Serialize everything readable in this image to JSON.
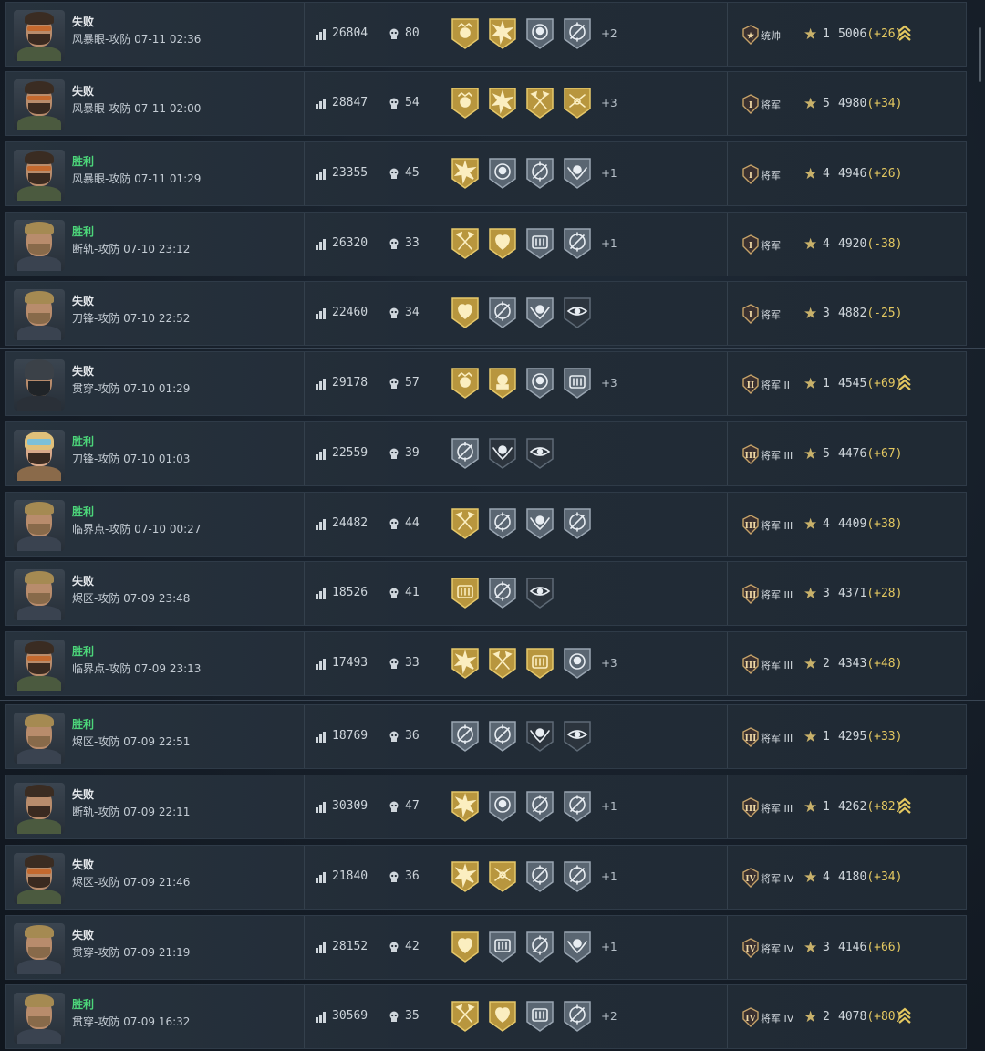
{
  "colors": {
    "win": "#4cd67a",
    "lose": "#e9ecef",
    "delta": "#e4c860",
    "gold_medal": "#b8963e",
    "silver_medal": "#5a6672"
  },
  "matches": [
    {
      "result": "失败",
      "result_type": "lose",
      "map": "风暴眼-攻防",
      "time": "07-11 02:36",
      "score": "26804",
      "kills": "80",
      "avatar": "male-glasses",
      "medals": [
        {
          "type": "gold",
          "icon": "skull-crown-icon"
        },
        {
          "type": "gold",
          "icon": "burst-icon"
        },
        {
          "type": "silver",
          "icon": "skull-icon"
        },
        {
          "type": "silver",
          "icon": "crosshair-icon"
        }
      ],
      "more": "+2",
      "rank_roman": "★",
      "rank_name": "统帅",
      "stars": "1",
      "rating": "5006",
      "delta": "(+26)",
      "promo": true
    },
    {
      "result": "失败",
      "result_type": "lose",
      "map": "风暴眼-攻防",
      "time": "07-11 02:00",
      "score": "28847",
      "kills": "54",
      "avatar": "male-glasses",
      "medals": [
        {
          "type": "gold",
          "icon": "skull-crown-icon"
        },
        {
          "type": "gold",
          "icon": "burst-icon"
        },
        {
          "type": "gold",
          "icon": "axes-icon"
        },
        {
          "type": "gold",
          "icon": "crossed-blades-icon"
        }
      ],
      "more": "+3",
      "rank_roman": "I",
      "rank_name": "将军",
      "stars": "5",
      "rating": "4980",
      "delta": "(+34)",
      "promo": false
    },
    {
      "result": "胜利",
      "result_type": "win",
      "map": "风暴眼-攻防",
      "time": "07-11 01:29",
      "score": "23355",
      "kills": "45",
      "avatar": "male-glasses",
      "medals": [
        {
          "type": "gold",
          "icon": "burst-icon"
        },
        {
          "type": "silver",
          "icon": "skull-icon"
        },
        {
          "type": "silver",
          "icon": "crosshair-icon"
        },
        {
          "type": "silver",
          "icon": "skull-wings-icon"
        }
      ],
      "more": "+1",
      "rank_roman": "I",
      "rank_name": "将军",
      "stars": "4",
      "rating": "4946",
      "delta": "(+26)",
      "promo": false
    },
    {
      "result": "胜利",
      "result_type": "win",
      "map": "断轨-攻防",
      "time": "07-10 23:12",
      "score": "26320",
      "kills": "33",
      "avatar": "male-blond",
      "medals": [
        {
          "type": "gold",
          "icon": "axes-icon"
        },
        {
          "type": "gold",
          "icon": "heart-icon"
        },
        {
          "type": "silver",
          "icon": "crate-icon"
        },
        {
          "type": "silver",
          "icon": "crosshair-icon"
        }
      ],
      "more": "+1",
      "rank_roman": "I",
      "rank_name": "将军",
      "stars": "4",
      "rating": "4920",
      "delta": "(-38)",
      "promo": false
    },
    {
      "result": "失败",
      "result_type": "lose",
      "map": "刀锋-攻防",
      "time": "07-10 22:52",
      "score": "22460",
      "kills": "34",
      "avatar": "male-blond",
      "medals": [
        {
          "type": "gold",
          "icon": "heart-icon"
        },
        {
          "type": "silver",
          "icon": "crosshair-icon"
        },
        {
          "type": "silver",
          "icon": "skull-wings-icon"
        },
        {
          "type": "dark",
          "icon": "eye-icon"
        }
      ],
      "more": "",
      "rank_roman": "I",
      "rank_name": "将军",
      "stars": "3",
      "rating": "4882",
      "delta": "(-25)",
      "promo": false
    },
    {
      "result": "失败",
      "result_type": "lose",
      "map": "贯穿-攻防",
      "time": "07-10 01:29",
      "score": "29178",
      "kills": "57",
      "avatar": "male-helmet",
      "medals": [
        {
          "type": "gold",
          "icon": "skull-crown-icon"
        },
        {
          "type": "gold",
          "icon": "skull-gold-icon"
        },
        {
          "type": "silver",
          "icon": "skull-icon"
        },
        {
          "type": "silver",
          "icon": "crate-icon"
        }
      ],
      "more": "+3",
      "rank_roman": "II",
      "rank_name": "将军 II",
      "stars": "1",
      "rating": "4545",
      "delta": "(+69)",
      "promo": true
    },
    {
      "result": "胜利",
      "result_type": "win",
      "map": "刀锋-攻防",
      "time": "07-10 01:03",
      "score": "22559",
      "kills": "39",
      "avatar": "female",
      "medals": [
        {
          "type": "silver",
          "icon": "crosshair-icon"
        },
        {
          "type": "dark",
          "icon": "skull-wings-icon"
        },
        {
          "type": "dark",
          "icon": "eye-icon"
        }
      ],
      "more": "",
      "rank_roman": "III",
      "rank_name": "将军 III",
      "stars": "5",
      "rating": "4476",
      "delta": "(+67)",
      "promo": false
    },
    {
      "result": "胜利",
      "result_type": "win",
      "map": "临界点-攻防",
      "time": "07-10 00:27",
      "score": "24482",
      "kills": "44",
      "avatar": "male-blond",
      "medals": [
        {
          "type": "gold",
          "icon": "axes-icon"
        },
        {
          "type": "silver",
          "icon": "crosshair-icon"
        },
        {
          "type": "silver",
          "icon": "skull-wings-icon"
        },
        {
          "type": "silver",
          "icon": "crosshair-icon"
        }
      ],
      "more": "",
      "rank_roman": "III",
      "rank_name": "将军 III",
      "stars": "4",
      "rating": "4409",
      "delta": "(+38)",
      "promo": false
    },
    {
      "result": "失败",
      "result_type": "lose",
      "map": "烬区-攻防",
      "time": "07-09 23:48",
      "score": "18526",
      "kills": "41",
      "avatar": "male-blond",
      "medals": [
        {
          "type": "gold",
          "icon": "crate-icon"
        },
        {
          "type": "silver",
          "icon": "crosshair-icon"
        },
        {
          "type": "dark",
          "icon": "eye-icon"
        }
      ],
      "more": "",
      "rank_roman": "III",
      "rank_name": "将军 III",
      "stars": "3",
      "rating": "4371",
      "delta": "(+28)",
      "promo": false
    },
    {
      "result": "胜利",
      "result_type": "win",
      "map": "临界点-攻防",
      "time": "07-09 23:13",
      "score": "17493",
      "kills": "33",
      "avatar": "male-glasses",
      "medals": [
        {
          "type": "gold",
          "icon": "burst-icon"
        },
        {
          "type": "gold",
          "icon": "axes-icon"
        },
        {
          "type": "gold",
          "icon": "crate-icon"
        },
        {
          "type": "silver",
          "icon": "skull-icon"
        }
      ],
      "more": "+3",
      "rank_roman": "III",
      "rank_name": "将军 III",
      "stars": "2",
      "rating": "4343",
      "delta": "(+48)",
      "promo": false
    },
    {
      "result": "胜利",
      "result_type": "win",
      "map": "烬区-攻防",
      "time": "07-09 22:51",
      "score": "18769",
      "kills": "36",
      "avatar": "male-blond",
      "medals": [
        {
          "type": "silver",
          "icon": "crosshair-icon"
        },
        {
          "type": "silver",
          "icon": "crosshair-icon"
        },
        {
          "type": "dark",
          "icon": "skull-wings-icon"
        },
        {
          "type": "dark",
          "icon": "eye-icon"
        }
      ],
      "more": "",
      "rank_roman": "III",
      "rank_name": "将军 III",
      "stars": "1",
      "rating": "4295",
      "delta": "(+33)",
      "promo": false
    },
    {
      "result": "失败",
      "result_type": "lose",
      "map": "断轨-攻防",
      "time": "07-09 22:11",
      "score": "30309",
      "kills": "47",
      "avatar": "male-dark",
      "medals": [
        {
          "type": "gold",
          "icon": "burst-icon"
        },
        {
          "type": "silver",
          "icon": "skull-icon"
        },
        {
          "type": "silver",
          "icon": "crosshair-icon"
        },
        {
          "type": "silver",
          "icon": "crosshair-icon"
        }
      ],
      "more": "+1",
      "rank_roman": "III",
      "rank_name": "将军 III",
      "stars": "1",
      "rating": "4262",
      "delta": "(+82)",
      "promo": true
    },
    {
      "result": "失败",
      "result_type": "lose",
      "map": "烬区-攻防",
      "time": "07-09 21:46",
      "score": "21840",
      "kills": "36",
      "avatar": "male-glasses",
      "medals": [
        {
          "type": "gold",
          "icon": "burst-icon"
        },
        {
          "type": "gold",
          "icon": "crossed-blades-icon"
        },
        {
          "type": "silver",
          "icon": "crosshair-icon"
        },
        {
          "type": "silver",
          "icon": "crosshair-icon"
        }
      ],
      "more": "+1",
      "rank_roman": "IV",
      "rank_name": "将军 IV",
      "stars": "4",
      "rating": "4180",
      "delta": "(+34)",
      "promo": false
    },
    {
      "result": "失败",
      "result_type": "lose",
      "map": "贯穿-攻防",
      "time": "07-09 21:19",
      "score": "28152",
      "kills": "42",
      "avatar": "male-blond",
      "medals": [
        {
          "type": "gold",
          "icon": "heart-icon"
        },
        {
          "type": "silver",
          "icon": "crate-icon"
        },
        {
          "type": "silver",
          "icon": "crosshair-icon"
        },
        {
          "type": "silver",
          "icon": "skull-wings-icon"
        }
      ],
      "more": "+1",
      "rank_roman": "IV",
      "rank_name": "将军 IV",
      "stars": "3",
      "rating": "4146",
      "delta": "(+66)",
      "promo": false
    },
    {
      "result": "胜利",
      "result_type": "win",
      "map": "贯穿-攻防",
      "time": "07-09 16:32",
      "score": "30569",
      "kills": "35",
      "avatar": "male-blond",
      "medals": [
        {
          "type": "gold",
          "icon": "axes-icon"
        },
        {
          "type": "gold",
          "icon": "heart-icon"
        },
        {
          "type": "silver",
          "icon": "crate-icon"
        },
        {
          "type": "silver",
          "icon": "crosshair-icon"
        }
      ],
      "more": "+2",
      "rank_roman": "IV",
      "rank_name": "将军 IV",
      "stars": "2",
      "rating": "4078",
      "delta": "(+80)",
      "promo": true
    }
  ]
}
